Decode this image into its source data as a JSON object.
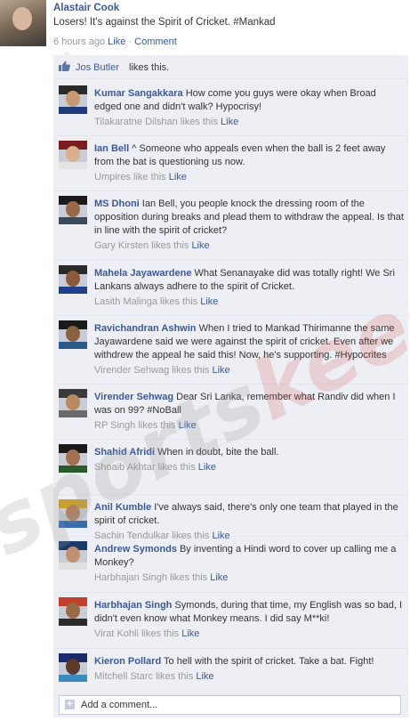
{
  "post": {
    "author": "Alastair Cook",
    "text": "Losers! It's against the Spirit of Cricket. #Mankad",
    "time": "6 hours ago",
    "like_link": "Like",
    "separator": "·",
    "comment_link": "Comment"
  },
  "likes": {
    "who": "Jos Butler",
    "rest": " likes this."
  },
  "comments": [
    {
      "name": "Kumar Sangakkara",
      "text": " How come you guys were okay when Broad edged one and didn't walk? Hypocrisy!",
      "liker": "Tilakaratne Dilshan likes this",
      "like": "Like",
      "avatar_colors": [
        "#2a2a2a",
        "#c89a72",
        "#1d3b7a"
      ]
    },
    {
      "name": "Ian Bell",
      "text": " ^ Someone who appeals even when the ball is 2 feet away from the bat is questioning us now.",
      "liker": "Umpires like this",
      "like": "Like",
      "avatar_colors": [
        "#7a1d1d",
        "#d8b090",
        "#e4e4e4"
      ]
    },
    {
      "name": "MS Dhoni",
      "text": " Ian Bell, you people knock the dressing room of the opposition during breaks and plead them to withdraw the appeal. Is that in line with the spirit of cricket?",
      "liker": "Gary Kirsten likes this",
      "like": "Like",
      "avatar_colors": [
        "#1a1a1a",
        "#9a6a48",
        "#3a4a5a"
      ]
    },
    {
      "name": "Mahela Jayawardene",
      "text": " What Senanayake did was totally right! We Sri Lankans always adhere to the spirit of Cricket.",
      "liker": "Lasith Malinga likes this",
      "like": "Like",
      "avatar_colors": [
        "#2a2a2a",
        "#8a5a3a",
        "#1e3f8a"
      ]
    },
    {
      "name": "Ravichandran Ashwin",
      "text": " When I tried to Mankad Thirimanne the same Jayawardene said we were against the spirit of cricket. Even after we withdrew the appeal he said this! Now, he's supporting. #Hypocrites",
      "liker": "Virender Sehwag likes this",
      "like": "Like",
      "avatar_colors": [
        "#1a1a1a",
        "#8a6040",
        "#2c5a8a"
      ]
    },
    {
      "name": "Virender Sehwag",
      "text": " Dear Sri Lanka, remember what Randiv did when I was on 99? #NoBall",
      "liker": "RP Singh likes this",
      "like": "Like",
      "avatar_colors": [
        "#3a3a3a",
        "#b88a62",
        "#6a6a6a"
      ]
    },
    {
      "name": "Shahid Afridi",
      "text": " When in doubt, bite the ball.",
      "liker": "Shoaib Akhtar likes this",
      "like": "Like",
      "avatar_colors": [
        "#1a1a1a",
        "#a07050",
        "#2a5a2a"
      ]
    },
    {
      "name": "Anil Kumble",
      "text": " I've always said, there's only one team that played in the spirit of cricket.",
      "liker": "Sachin Tendulkar likes this",
      "like": "Like",
      "avatar_colors": [
        "#c8a030",
        "#b08060",
        "#3a6ab0"
      ]
    },
    {
      "name": "Andrew Symonds",
      "text": " By inventing a Hindi word to cover up calling me a Monkey?",
      "liker": "Harbhajan Singh likes this",
      "like": "Like",
      "avatar_colors": [
        "#1a3a6a",
        "#c09070",
        "#e0e0e0"
      ]
    },
    {
      "name": "Harbhajan Singh",
      "text": " Symonds, during that time, my English was so bad, I didn't even know what Monkey means. I did say M**ki!",
      "liker": "Virat Kohli likes this",
      "like": "Like",
      "avatar_colors": [
        "#c04030",
        "#9a6a48",
        "#2a2a2a"
      ]
    },
    {
      "name": "Kieron Pollard",
      "text": " To hell with the spirit of cricket. Take a bat. Fight!",
      "liker": "Mitchell Starc likes this",
      "like": "Like",
      "avatar_colors": [
        "#1a2a6a",
        "#5a3a28",
        "#3a8ac0"
      ]
    }
  ],
  "add_comment": {
    "icon": "+",
    "placeholder": "Add a comment..."
  },
  "watermark": {
    "part1": "sports",
    "part2": "keeda"
  }
}
